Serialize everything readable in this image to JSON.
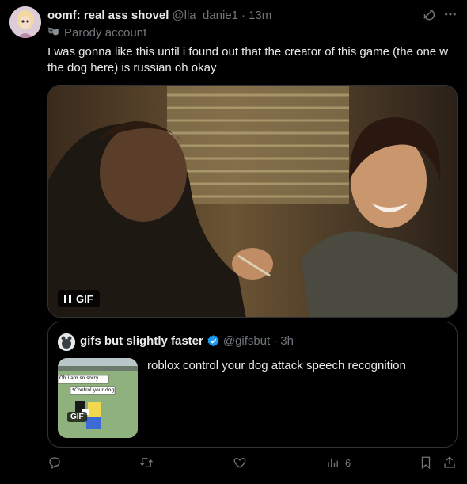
{
  "tweet": {
    "display_name": "oomf: real ass shovel",
    "handle": "@lla_danie1",
    "separator": "·",
    "time": "13m",
    "parody_label": "Parody account",
    "text": "I was gonna like this until i found out that the creator of this game (the one w the dog here) is russian oh okay",
    "media_badge": "GIF"
  },
  "quote": {
    "display_name": "gifs but slightly faster",
    "handle": "@gifsbut",
    "separator": "·",
    "time": "3h",
    "text": "roblox control your dog attack speech recognition",
    "thumb_badge": "GIF",
    "thumb_chat_1": "Oh I am so sorry",
    "thumb_chat_2": "*Control your dog"
  },
  "actions": {
    "reply": "",
    "retweet": "",
    "like": "",
    "views": "6"
  },
  "icons": {
    "header_right": [
      "grok-icon",
      "more-icon"
    ],
    "parody": "theater-mask-icon",
    "actions": [
      "reply-icon",
      "retweet-icon",
      "like-icon",
      "views-icon",
      "bookmark-icon",
      "share-icon"
    ]
  },
  "colors": {
    "background": "#000000",
    "text": "#e7e9ea",
    "muted": "#71767b",
    "border": "#2f3336",
    "verified": "#1d9bf0"
  }
}
